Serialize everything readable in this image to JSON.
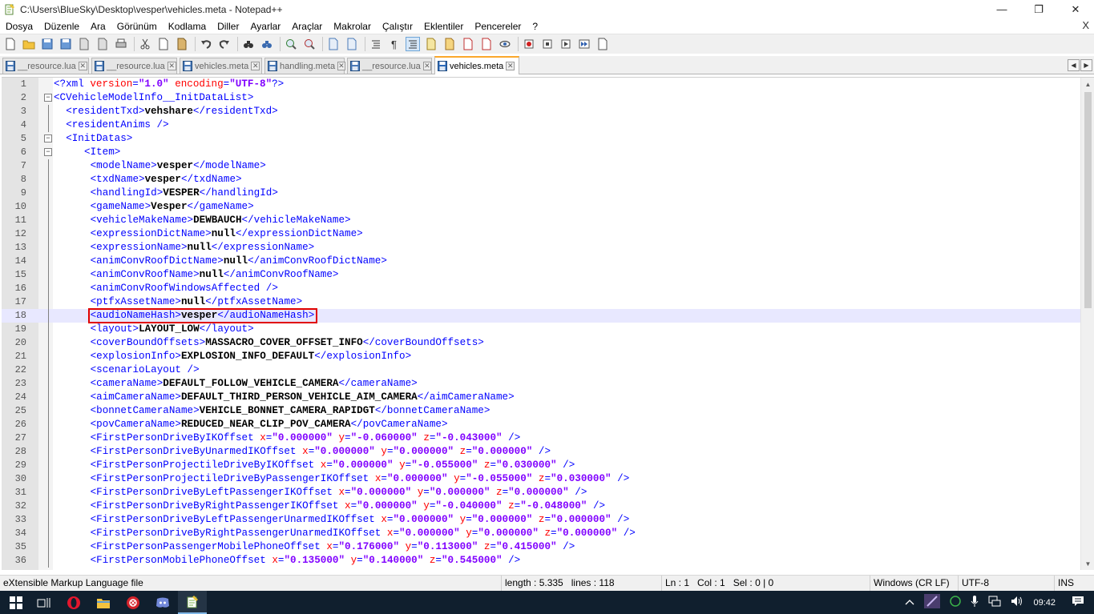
{
  "window": {
    "title": "C:\\Users\\BlueSky\\Desktop\\vesper\\vehicles.meta - Notepad++",
    "minimize": "—",
    "maximize": "❐",
    "close": "✕"
  },
  "menu": {
    "items": [
      "Dosya",
      "Düzenle",
      "Ara",
      "Görünüm",
      "Kodlama",
      "Diller",
      "Ayarlar",
      "Araçlar",
      "Makrolar",
      "Çalıştır",
      "Eklentiler",
      "Pencereler",
      "?"
    ],
    "close": "X"
  },
  "tabs": [
    {
      "label": "__resource.lua",
      "active": false
    },
    {
      "label": "__resource.lua",
      "active": false
    },
    {
      "label": "vehicles.meta",
      "active": false
    },
    {
      "label": "handling.meta",
      "active": false
    },
    {
      "label": "__resource.lua",
      "active": false
    },
    {
      "label": "vehicles.meta",
      "active": true
    }
  ],
  "editor": {
    "current_line": 18,
    "highlighted_line": 18,
    "lines": [
      {
        "n": "1",
        "fold": "",
        "indent": 0,
        "kind": "pi",
        "text": "<?xml version=\"1.0\" encoding=\"UTF-8\"?>"
      },
      {
        "n": "2",
        "fold": "minus",
        "indent": 0,
        "kind": "open",
        "tag": "CVehicleModelInfo__InitDataList"
      },
      {
        "n": "3",
        "fold": "line",
        "indent": 2,
        "kind": "elem",
        "tag": "residentTxd",
        "value": "vehshare"
      },
      {
        "n": "4",
        "fold": "line",
        "indent": 2,
        "kind": "selfclose",
        "tag": "residentAnims"
      },
      {
        "n": "5",
        "fold": "minus",
        "indent": 2,
        "kind": "open",
        "tag": "InitDatas"
      },
      {
        "n": "6",
        "fold": "minus",
        "indent": 5,
        "kind": "open",
        "tag": "Item"
      },
      {
        "n": "7",
        "fold": "line",
        "indent": 6,
        "kind": "elem",
        "tag": "modelName",
        "value": "vesper"
      },
      {
        "n": "8",
        "fold": "line",
        "indent": 6,
        "kind": "elem",
        "tag": "txdName",
        "value": "vesper"
      },
      {
        "n": "9",
        "fold": "line",
        "indent": 6,
        "kind": "elem",
        "tag": "handlingId",
        "value": "VESPER"
      },
      {
        "n": "10",
        "fold": "line",
        "indent": 6,
        "kind": "elem",
        "tag": "gameName",
        "value": "Vesper"
      },
      {
        "n": "11",
        "fold": "line",
        "indent": 6,
        "kind": "elem",
        "tag": "vehicleMakeName",
        "value": "DEWBAUCH"
      },
      {
        "n": "12",
        "fold": "line",
        "indent": 6,
        "kind": "elem",
        "tag": "expressionDictName",
        "value": "null"
      },
      {
        "n": "13",
        "fold": "line",
        "indent": 6,
        "kind": "elem",
        "tag": "expressionName",
        "value": "null"
      },
      {
        "n": "14",
        "fold": "line",
        "indent": 6,
        "kind": "elem",
        "tag": "animConvRoofDictName",
        "value": "null"
      },
      {
        "n": "15",
        "fold": "line",
        "indent": 6,
        "kind": "elem",
        "tag": "animConvRoofName",
        "value": "null"
      },
      {
        "n": "16",
        "fold": "line",
        "indent": 6,
        "kind": "selfclose",
        "tag": "animConvRoofWindowsAffected"
      },
      {
        "n": "17",
        "fold": "line",
        "indent": 6,
        "kind": "elem",
        "tag": "ptfxAssetName",
        "value": "null"
      },
      {
        "n": "18",
        "fold": "line",
        "indent": 6,
        "kind": "elem",
        "tag": "audioNameHash",
        "value": "vesper"
      },
      {
        "n": "19",
        "fold": "line",
        "indent": 6,
        "kind": "elem",
        "tag": "layout",
        "value": "LAYOUT_LOW"
      },
      {
        "n": "20",
        "fold": "line",
        "indent": 6,
        "kind": "elem",
        "tag": "coverBoundOffsets",
        "value": "MASSACRO_COVER_OFFSET_INFO"
      },
      {
        "n": "21",
        "fold": "line",
        "indent": 6,
        "kind": "elem",
        "tag": "explosionInfo",
        "value": "EXPLOSION_INFO_DEFAULT"
      },
      {
        "n": "22",
        "fold": "line",
        "indent": 6,
        "kind": "selfclose",
        "tag": "scenarioLayout"
      },
      {
        "n": "23",
        "fold": "line",
        "indent": 6,
        "kind": "elem",
        "tag": "cameraName",
        "value": "DEFAULT_FOLLOW_VEHICLE_CAMERA"
      },
      {
        "n": "24",
        "fold": "line",
        "indent": 6,
        "kind": "elem",
        "tag": "aimCameraName",
        "value": "DEFAULT_THIRD_PERSON_VEHICLE_AIM_CAMERA"
      },
      {
        "n": "25",
        "fold": "line",
        "indent": 6,
        "kind": "elem",
        "tag": "bonnetCameraName",
        "value": "VEHICLE_BONNET_CAMERA_RAPIDGT"
      },
      {
        "n": "26",
        "fold": "line",
        "indent": 6,
        "kind": "elem",
        "tag": "povCameraName",
        "value": "REDUCED_NEAR_CLIP_POV_CAMERA"
      },
      {
        "n": "27",
        "fold": "line",
        "indent": 6,
        "kind": "attrs",
        "tag": "FirstPersonDriveByIKOffset",
        "x": "0.000000",
        "y": "-0.060000",
        "z": "-0.043000"
      },
      {
        "n": "28",
        "fold": "line",
        "indent": 6,
        "kind": "attrs",
        "tag": "FirstPersonDriveByUnarmedIKOffset",
        "x": "0.000000",
        "y": "0.000000",
        "z": "0.000000"
      },
      {
        "n": "29",
        "fold": "line",
        "indent": 6,
        "kind": "attrs",
        "tag": "FirstPersonProjectileDriveByIKOffset",
        "x": "0.000000",
        "y": "-0.055000",
        "z": "0.030000"
      },
      {
        "n": "30",
        "fold": "line",
        "indent": 6,
        "kind": "attrs",
        "tag": "FirstPersonProjectileDriveByPassengerIKOffset",
        "x": "0.000000",
        "y": "-0.055000",
        "z": "0.030000"
      },
      {
        "n": "31",
        "fold": "line",
        "indent": 6,
        "kind": "attrs",
        "tag": "FirstPersonDriveByLeftPassengerIKOffset",
        "x": "0.000000",
        "y": "0.000000",
        "z": "0.000000"
      },
      {
        "n": "32",
        "fold": "line",
        "indent": 6,
        "kind": "attrs",
        "tag": "FirstPersonDriveByRightPassengerIKOffset",
        "x": "0.000000",
        "y": "-0.040000",
        "z": "-0.048000"
      },
      {
        "n": "33",
        "fold": "line",
        "indent": 6,
        "kind": "attrs",
        "tag": "FirstPersonDriveByLeftPassengerUnarmedIKOffset",
        "x": "0.000000",
        "y": "0.000000",
        "z": "0.000000"
      },
      {
        "n": "34",
        "fold": "line",
        "indent": 6,
        "kind": "attrs",
        "tag": "FirstPersonDriveByRightPassengerUnarmedIKOffset",
        "x": "0.000000",
        "y": "0.000000",
        "z": "0.000000"
      },
      {
        "n": "35",
        "fold": "line",
        "indent": 6,
        "kind": "attrs",
        "tag": "FirstPersonPassengerMobilePhoneOffset",
        "x": "0.176000",
        "y": "0.113000",
        "z": "0.415000"
      },
      {
        "n": "36",
        "fold": "line",
        "indent": 6,
        "kind": "attrs",
        "tag": "FirstPersonMobilePhoneOffset",
        "x": "0.135000",
        "y": "0.140000",
        "z": "0.545000"
      }
    ]
  },
  "status": {
    "filetype": "eXtensible Markup Language file",
    "length": "length : 5.335",
    "lines": "lines : 118",
    "ln": "Ln : 1",
    "col": "Col : 1",
    "sel": "Sel : 0 | 0",
    "eol": "Windows (CR LF)",
    "encoding": "UTF-8",
    "mode": "INS"
  },
  "taskbar": {
    "time": "09:42",
    "apps": [
      "windows-start",
      "task-view",
      "opera",
      "file-explorer",
      "app-red",
      "discord",
      "notepadpp"
    ]
  },
  "colors": {
    "tag": "#0000ff",
    "attr": "#ff0000",
    "attrvalue": "#8000ff",
    "highlight_border": "#e00000",
    "taskbar": "#101f2e"
  }
}
